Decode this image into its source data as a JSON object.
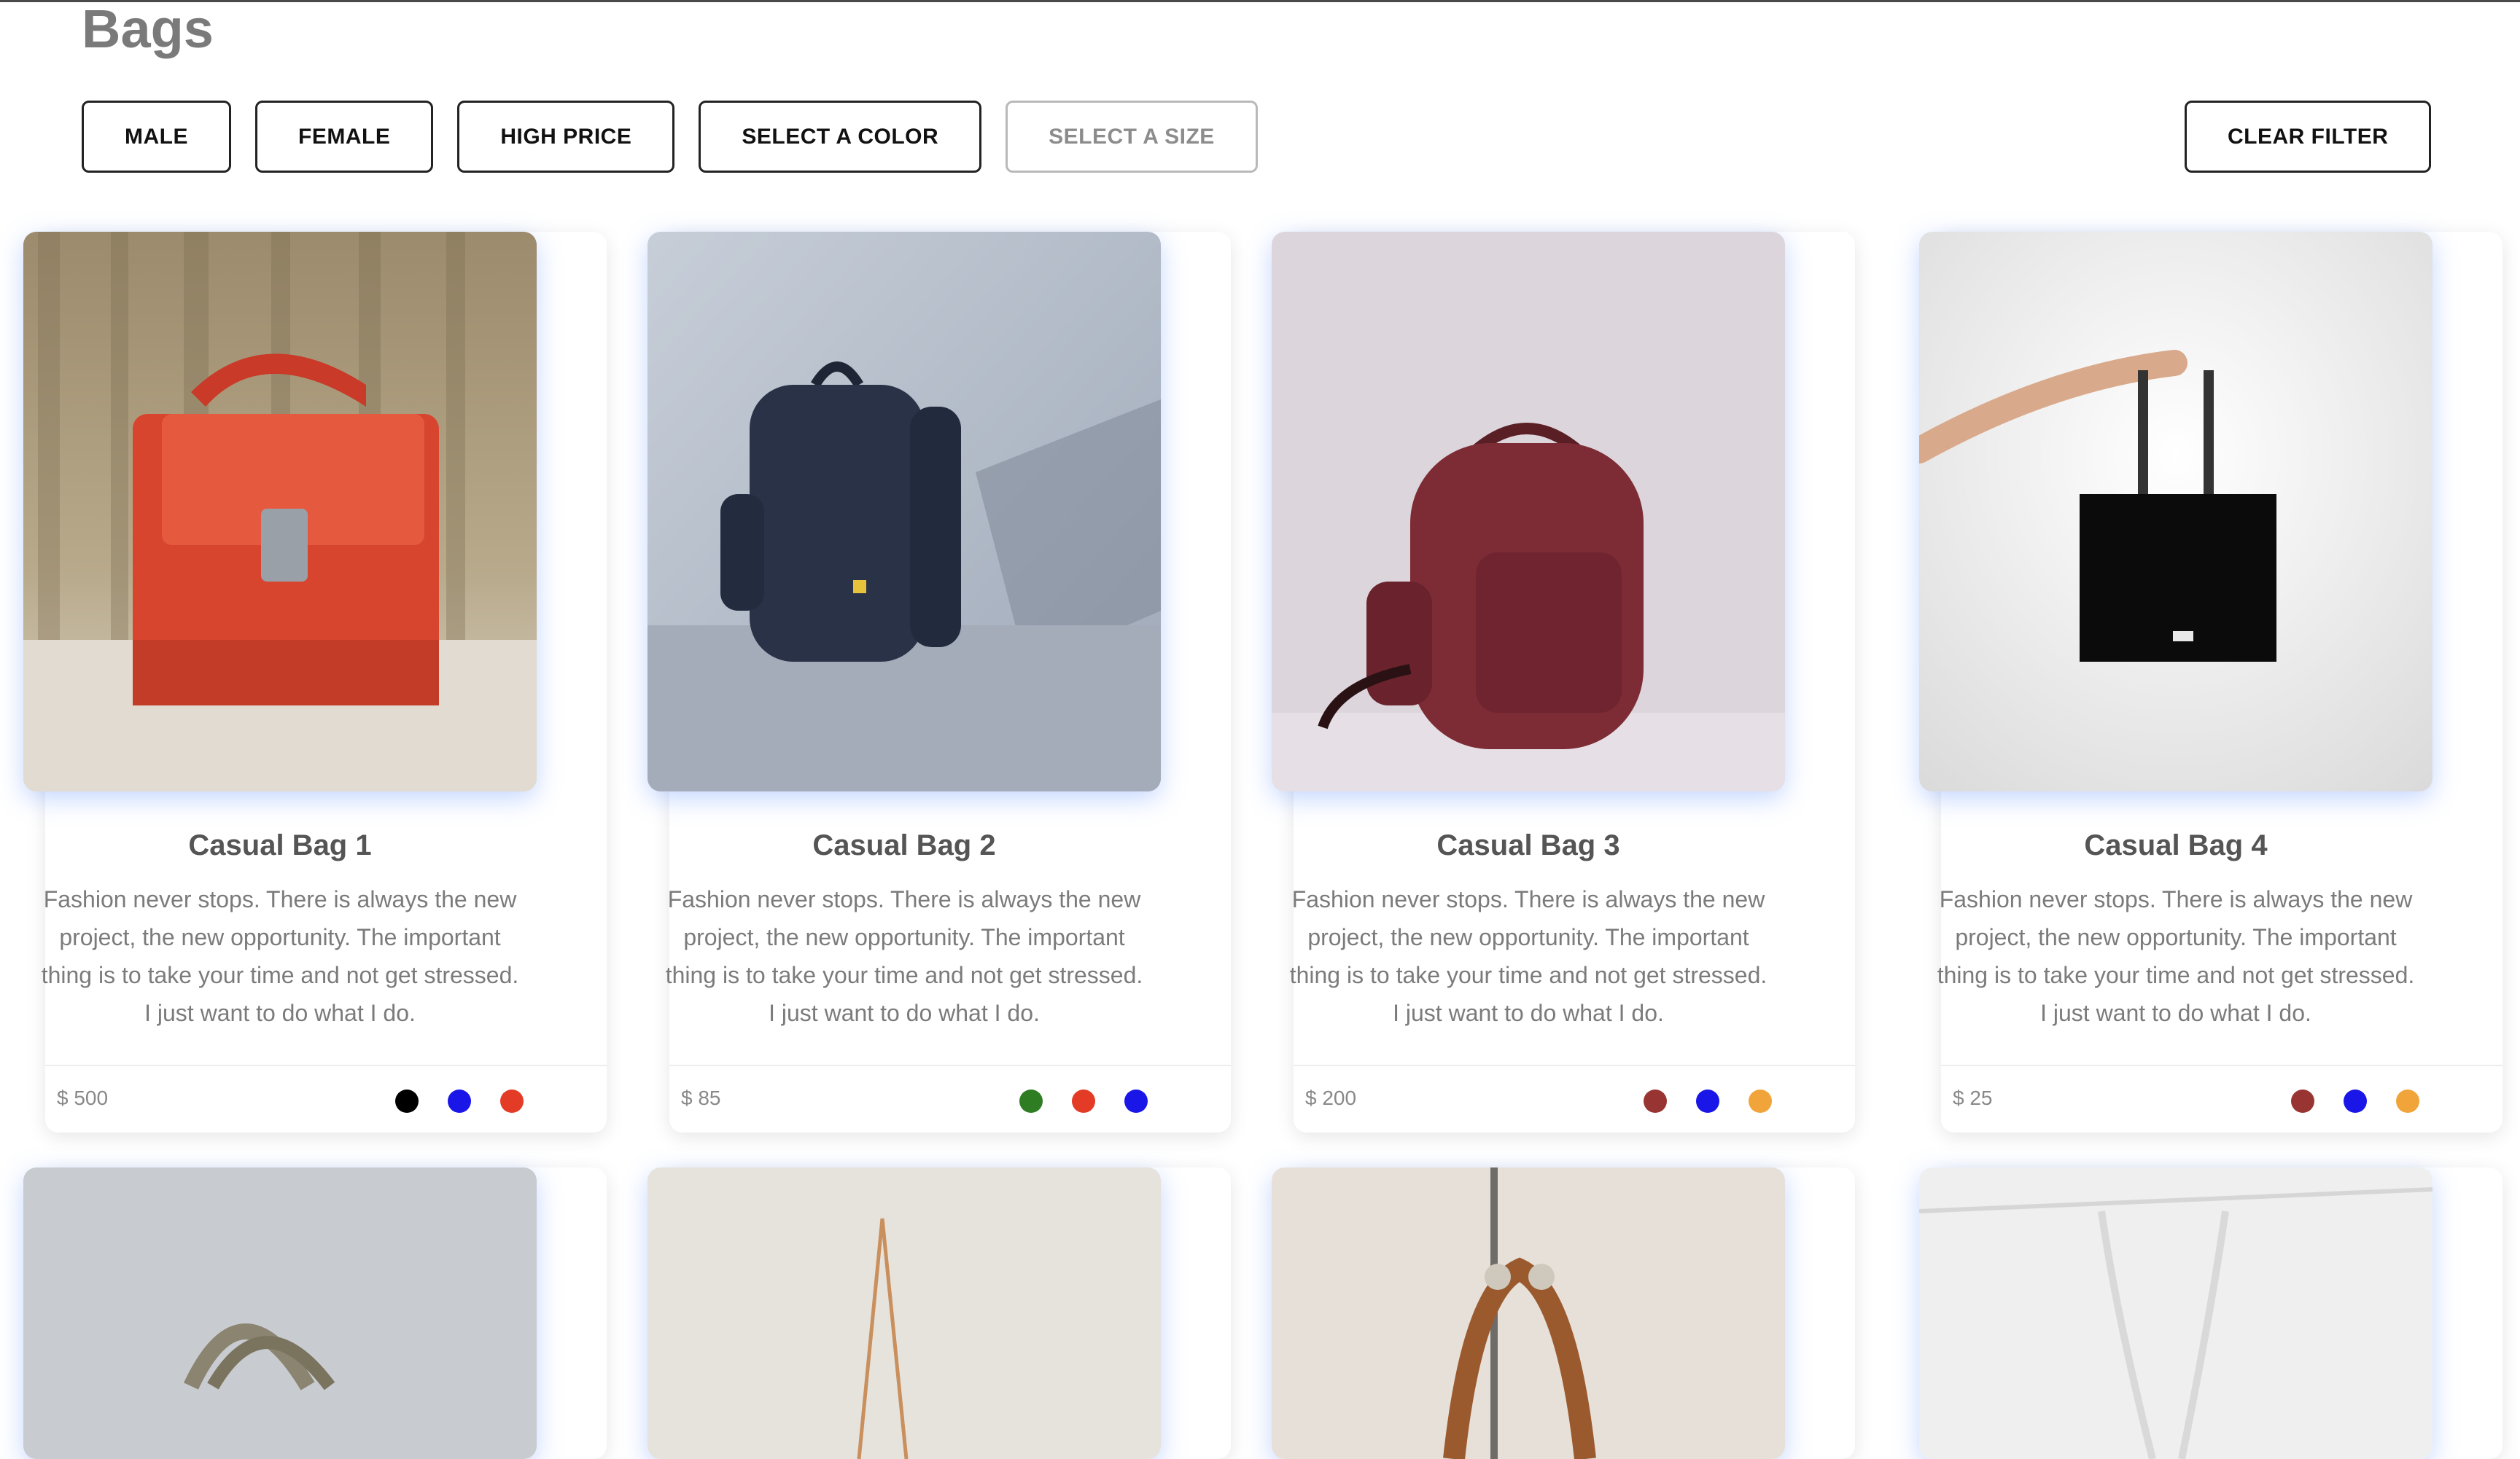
{
  "page": {
    "title": "Bags"
  },
  "filters": {
    "male": "MALE",
    "female": "FEMALE",
    "high_price": "HIGH PRICE",
    "select_color": "SELECT A COLOR",
    "select_size": "SELECT A SIZE",
    "clear": "CLEAR FILTER"
  },
  "products": [
    {
      "title": "Casual Bag 1",
      "description": "Fashion never stops. There is always the new project, the new opportunity. The important thing is to take your time and not get stressed. I just want to do what I do.",
      "price": "$ 500",
      "colors": [
        "#000000",
        "#1a16e8",
        "#e33b25"
      ]
    },
    {
      "title": "Casual Bag 2",
      "description": "Fashion never stops. There is always the new project, the new opportunity. The important thing is to take your time and not get stressed. I just want to do what I do.",
      "price": "$ 85",
      "colors": [
        "#2e7d23",
        "#e33b25",
        "#1a16e8"
      ]
    },
    {
      "title": "Casual Bag 3",
      "description": "Fashion never stops. There is always the new project, the new opportunity. The important thing is to take your time and not get stressed. I just want to do what I do.",
      "price": "$ 200",
      "colors": [
        "#983532",
        "#1a16e8",
        "#f0a43a"
      ]
    },
    {
      "title": "Casual Bag 4",
      "description": "Fashion never stops. There is always the new project, the new opportunity. The important thing is to take your time and not get stressed. I just want to do what I do.",
      "price": "$ 25",
      "colors": [
        "#983532",
        "#1a16e8",
        "#f0a43a"
      ]
    }
  ]
}
